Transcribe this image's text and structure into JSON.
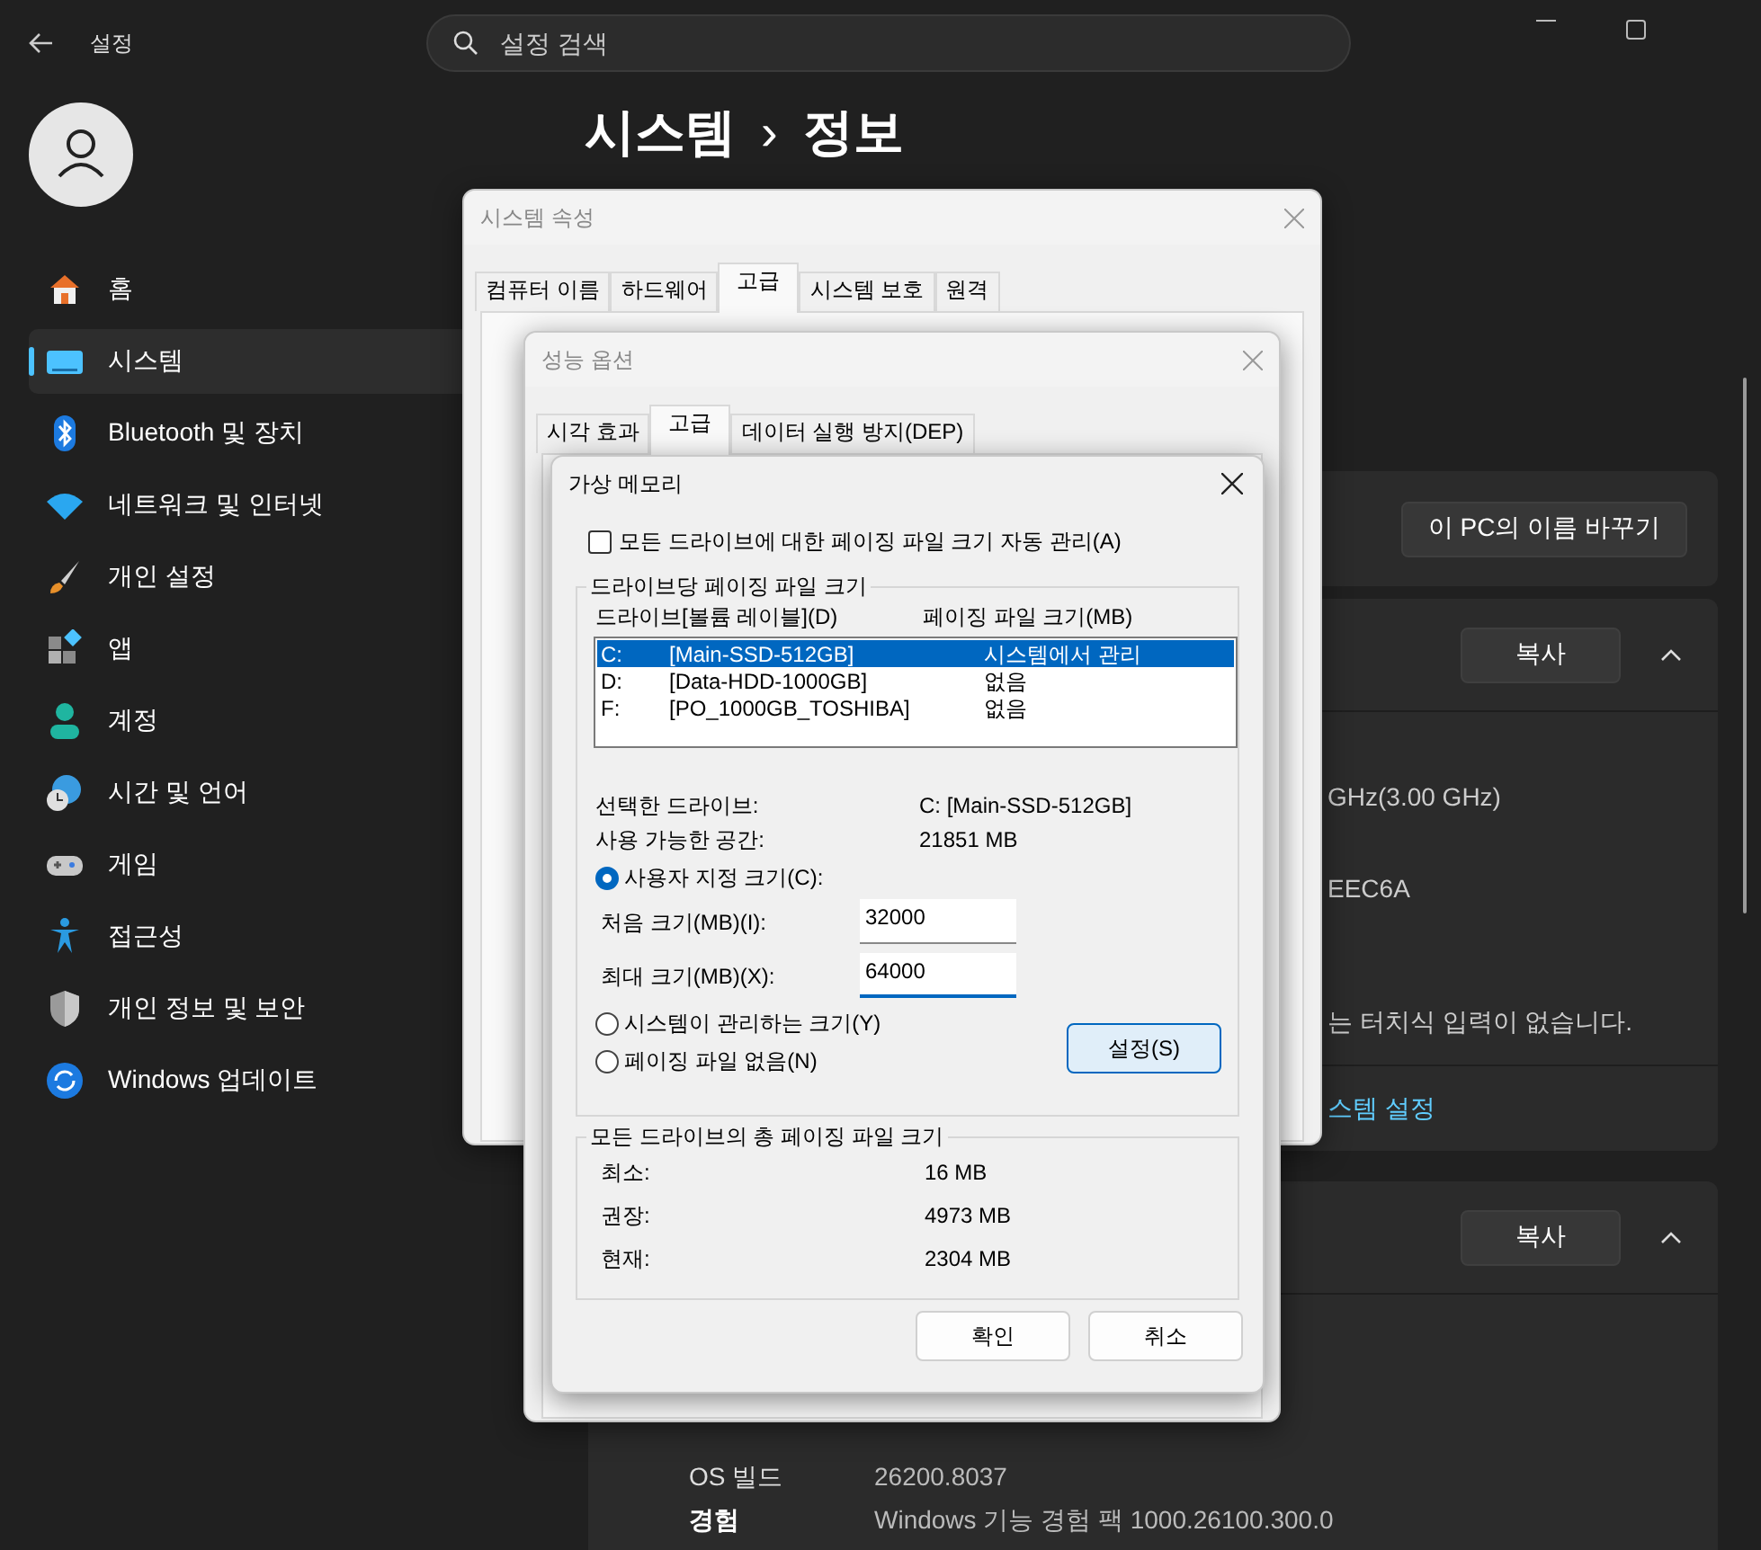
{
  "titlebar": {
    "app_title": "설정"
  },
  "search": {
    "placeholder": "설정 검색"
  },
  "sidebar": {
    "items": [
      {
        "label": "홈",
        "selected": false
      },
      {
        "label": "시스템",
        "selected": true
      },
      {
        "label": "Bluetooth 및 장치",
        "selected": false
      },
      {
        "label": "네트워크 및 인터넷",
        "selected": false
      },
      {
        "label": "개인 설정",
        "selected": false
      },
      {
        "label": "앱",
        "selected": false
      },
      {
        "label": "계정",
        "selected": false
      },
      {
        "label": "시간 및 언어",
        "selected": false
      },
      {
        "label": "게임",
        "selected": false
      },
      {
        "label": "접근성",
        "selected": false
      },
      {
        "label": "개인 정보 및 보안",
        "selected": false
      },
      {
        "label": "Windows 업데이트",
        "selected": false
      }
    ]
  },
  "page": {
    "breadcrumb": [
      "시스템",
      "정보"
    ],
    "separator": "›"
  },
  "device_card": {
    "rename_button": "이 PC의 이름 바꾸기"
  },
  "spec_card": {
    "copy_button": "복사",
    "expanded": true,
    "lines": [
      "GHz(3.00 GHz)",
      "EEC6A",
      "는 터치식 입력이 없습니다."
    ],
    "link": "스템 설정"
  },
  "windows_card": {
    "copy_button": "복사",
    "expanded": true,
    "rows": [
      {
        "label": "OS 빌드",
        "value": "26200.8037"
      },
      {
        "label": "경험",
        "value": "Windows 기능 경험 팩 1000.26100.300.0"
      }
    ]
  },
  "system_properties": {
    "title": "시스템 속성",
    "tabs": [
      {
        "label": "컴퓨터 이름",
        "selected": false
      },
      {
        "label": "하드웨어",
        "selected": false
      },
      {
        "label": "고급",
        "selected": true
      },
      {
        "label": "시스템 보호",
        "selected": false
      },
      {
        "label": "원격",
        "selected": false
      }
    ]
  },
  "performance_options": {
    "title": "성능 옵션",
    "tabs": [
      {
        "label": "시각 효과",
        "selected": false
      },
      {
        "label": "고급",
        "selected": true
      },
      {
        "label": "데이터 실행 방지(DEP)",
        "selected": false
      }
    ]
  },
  "virtual_memory": {
    "title": "가상 메모리",
    "auto_manage": {
      "label": "모든 드라이브에 대한 페이징 파일 크기 자동 관리(A)",
      "checked": false
    },
    "per_drive_group": "드라이브당 페이징 파일 크기",
    "columns": [
      "드라이브[볼륨 레이블](D)",
      "페이징 파일 크기(MB)"
    ],
    "drives": [
      {
        "drive": "C:",
        "label": "[Main-SSD-512GB]",
        "size": "시스템에서 관리",
        "selected": true
      },
      {
        "drive": "D:",
        "label": "[Data-HDD-1000GB]",
        "size": "없음",
        "selected": false
      },
      {
        "drive": "F:",
        "label": "[PO_1000GB_TOSHIBA]",
        "size": "없음",
        "selected": false
      }
    ],
    "selected_drive": {
      "label": "선택한 드라이브:",
      "value": "C:  [Main-SSD-512GB]"
    },
    "free_space": {
      "label": "사용 가능한 공간:",
      "value": "21851 MB"
    },
    "custom_size": {
      "label": "사용자 지정 크기(C):",
      "selected": true
    },
    "initial_size": {
      "label": "처음 크기(MB)(I):",
      "value": "32000"
    },
    "max_size": {
      "label": "최대 크기(MB)(X):",
      "value": "64000"
    },
    "system_managed": {
      "label": "시스템이 관리하는 크기(Y)",
      "selected": false
    },
    "no_paging": {
      "label": "페이징 파일 없음(N)",
      "selected": false
    },
    "set_button": "설정(S)",
    "total_group": "모든 드라이브의 총 페이징 파일 크기",
    "totals": [
      {
        "label": "최소:",
        "value": "16 MB"
      },
      {
        "label": "권장:",
        "value": "4973 MB"
      },
      {
        "label": "현재:",
        "value": "2304 MB"
      }
    ],
    "buttons": [
      "확인",
      "취소"
    ]
  }
}
